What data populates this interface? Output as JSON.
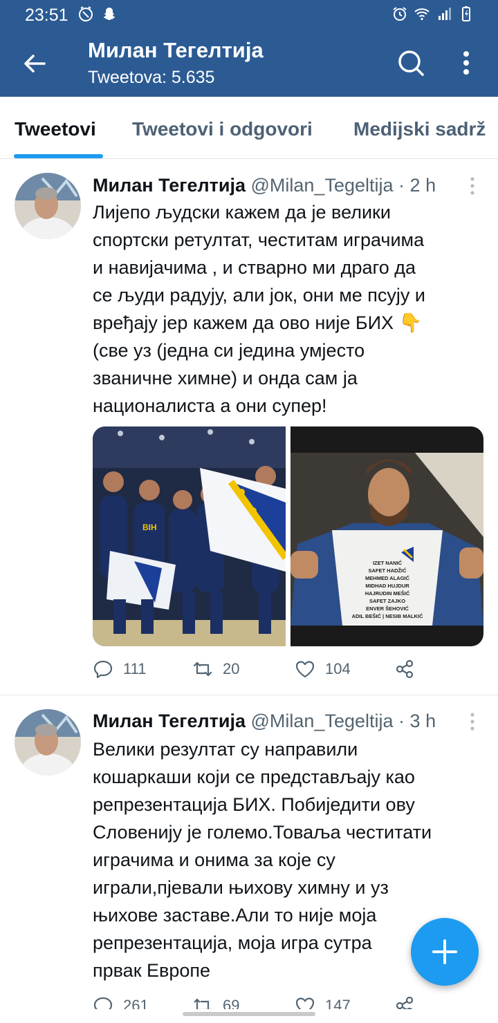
{
  "status_bar": {
    "time": "23:51"
  },
  "header": {
    "name": "Милан Тегелтија",
    "tweet_count": "Tweetova: 5.635"
  },
  "tabs": [
    {
      "label": "Tweetovi"
    },
    {
      "label": "Tweetovi i odgovori"
    },
    {
      "label": "Medijski sadrž"
    }
  ],
  "tweets": [
    {
      "name": "Милан Тегелтија",
      "handle": "@Milan_Tegeltija",
      "time": "2 h",
      "lines": [
        "Лијепо људски кажем да је велики",
        "спортски ретултат, честитам играчима",
        "и навијачима , и стварно  ми драго да",
        "се људи радују, али јок, они ме псују и",
        "вређају јер кажем да ово није БИХ 👇",
        "(све уз (једна си једина умјесто",
        "званичне химне) и онда сам ја",
        "националиста а они супер!"
      ],
      "shirt_text": [
        "IZET NANIĆ",
        "SAFET HADŽIĆ",
        "MEHMED ALAGIĆ",
        "MIDHAD HUJDUR",
        "HAJRUDIN MEŠIĆ",
        "SAFET ZAJKO",
        "ENVER ŠEHOVIĆ",
        "ADIL BEŠIĆ | NESIB MALKIĆ"
      ],
      "flag_text": "BIH",
      "replies": "111",
      "retweets": "20",
      "likes": "104"
    },
    {
      "name": "Милан Тегелтија",
      "handle": "@Milan_Tegeltija",
      "time": "3 h",
      "lines": [
        "Велики резултат су направили",
        "кошаркаши који се представљају као",
        "репрезентација БИХ. Побиједити ову",
        "Словенију је големо.Товаља честитати",
        "играчима и онима за које су",
        "играли,пјевали њихову химну и уз",
        "њихове заставе.Али то није моја",
        "репрезентација, моја игра сутра",
        "првак Европе"
      ],
      "replies": "261",
      "retweets": "69",
      "likes": "147"
    }
  ],
  "colors": {
    "header_bg": "#2c5b93",
    "accent": "#1d9bf0",
    "secondary_text": "#536471"
  }
}
